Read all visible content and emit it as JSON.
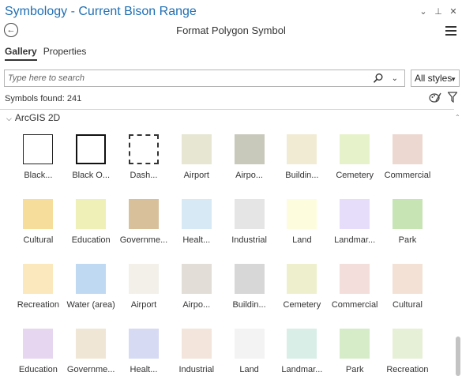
{
  "window": {
    "title": "Symbology - Current Bison Range",
    "controls": [
      "⌄",
      "⊥",
      "✕"
    ]
  },
  "header": {
    "title": "Format Polygon Symbol"
  },
  "tabs": [
    {
      "label": "Gallery",
      "active": true
    },
    {
      "label": "Properties",
      "active": false
    }
  ],
  "search": {
    "placeholder": "Type here to search",
    "value": ""
  },
  "styles_select": {
    "selected": "All styles"
  },
  "symbols_found": "Symbols found: 241",
  "section": {
    "title": "ArcGIS 2D"
  },
  "colors": {
    "title": "#1f6fb3"
  },
  "symbols": [
    {
      "label": "Black...",
      "style": "outline"
    },
    {
      "label": "Black O...",
      "style": "outline-thick"
    },
    {
      "label": "Dash...",
      "style": "dash"
    },
    {
      "label": "Airport",
      "color": "#e6e6d3"
    },
    {
      "label": "Airpo...",
      "color": "#c8c8bb"
    },
    {
      "label": "Buildin...",
      "color": "#f2ebd3"
    },
    {
      "label": "Cemetery",
      "color": "#e6f2c9"
    },
    {
      "label": "Commercial",
      "color": "#ecd8d0"
    },
    {
      "label": "Cultural",
      "color": "#f7dd9c"
    },
    {
      "label": "Education",
      "color": "#eef0b8"
    },
    {
      "label": "Governme...",
      "color": "#d8c09a"
    },
    {
      "label": "Healt...",
      "color": "#d6e9f4"
    },
    {
      "label": "Industrial",
      "color": "#e5e5e5"
    },
    {
      "label": "Land",
      "color": "#fdfddd"
    },
    {
      "label": "Landmar...",
      "color": "#e6ddfb"
    },
    {
      "label": "Park",
      "color": "#c6e4b4"
    },
    {
      "label": "Recreation",
      "color": "#fce8bd"
    },
    {
      "label": "Water (area)",
      "color": "#bfd9f2"
    },
    {
      "label": "Airport",
      "color": "#f2f0e9"
    },
    {
      "label": "Airpo...",
      "color": "#e3ddd7"
    },
    {
      "label": "Buildin...",
      "color": "#d7d7d7"
    },
    {
      "label": "Cemetery",
      "color": "#eef0cd"
    },
    {
      "label": "Commercial",
      "color": "#f3dedb"
    },
    {
      "label": "Cultural",
      "color": "#f3e1d6"
    },
    {
      "label": "Education",
      "color": "#e6d6ef"
    },
    {
      "label": "Governme...",
      "color": "#f0e6d6"
    },
    {
      "label": "Healt...",
      "color": "#d6daf3"
    },
    {
      "label": "Industrial",
      "color": "#f3e5dc"
    },
    {
      "label": "Land",
      "color": "#f3f3f3"
    },
    {
      "label": "Landmar...",
      "color": "#d8eee6"
    },
    {
      "label": "Park",
      "color": "#d6ecc8"
    },
    {
      "label": "Recreation",
      "color": "#e6f0d6"
    }
  ]
}
